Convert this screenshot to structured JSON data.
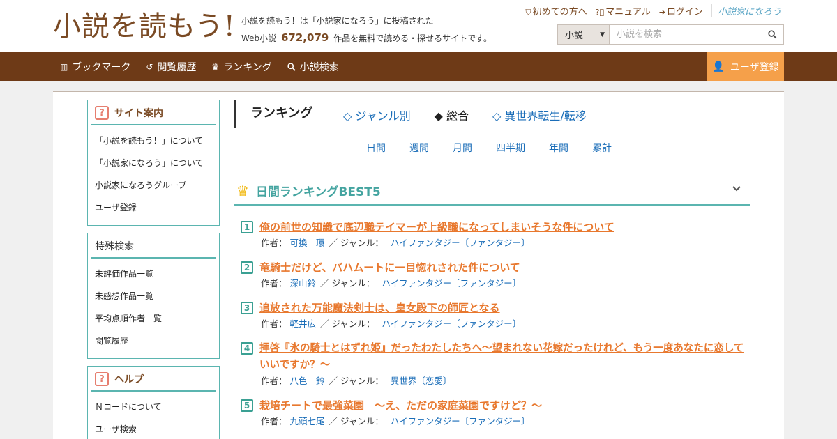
{
  "header": {
    "logo": "小説を読もう!",
    "tagline_line1": "小説を読もう！は「小説家になろう」に投稿された",
    "tagline_prefix": "Web小説",
    "work_count": "672,079",
    "tagline_suffix": "作品を無料で読める・探せるサイトです。",
    "links": [
      {
        "icon": "beginner-icon",
        "label": "初めての方へ"
      },
      {
        "icon": "help-icon",
        "label": "マニュアル"
      },
      {
        "icon": "login-icon",
        "label": "ログイン"
      }
    ],
    "partner_logo": "小説家になろう",
    "search": {
      "category": "小説",
      "placeholder": "小説を検索"
    }
  },
  "nav": {
    "items": [
      {
        "icon": "bookmark-icon",
        "label": "ブックマーク"
      },
      {
        "icon": "history-icon",
        "label": "閲覧履歴"
      },
      {
        "icon": "crown-icon",
        "label": "ランキング"
      },
      {
        "icon": "search-icon",
        "label": "小説検索"
      }
    ],
    "register": "ユーザ登録"
  },
  "sidebar": {
    "site_guide": {
      "title": "サイト案内",
      "items": [
        "「小説を読もう！」について",
        "「小説家になろう」について",
        "小説家になろうグループ",
        "ユーザ登録"
      ]
    },
    "special_search": {
      "title": "特殊検索",
      "items": [
        "未評価作品一覧",
        "未感想作品一覧",
        "平均点順作者一覧",
        "閲覧履歴"
      ]
    },
    "help": {
      "title": "ヘルプ",
      "items": [
        "Ｎコードについて",
        "ユーザ検索"
      ]
    }
  },
  "ranking": {
    "title": "ランキング",
    "tabs": [
      "◇ ジャンル別",
      "◆ 総合",
      "◇ 異世界転生/転移"
    ],
    "periods": [
      "日間",
      "週間",
      "月間",
      "四半期",
      "年間",
      "累計"
    ],
    "section_title": "日間ランキングBEST5",
    "author_label": "作者：",
    "genre_label": "／ ジャンル：",
    "entries": [
      {
        "rank": "1",
        "title": "俺の前世の知識で底辺職テイマーが上級職になってしまいそうな件について",
        "author": "可換　環",
        "genre": "ハイファンタジー〔ファンタジー〕"
      },
      {
        "rank": "2",
        "title": "竜騎士だけど、バハムートに一目惚れされた件について",
        "author": "深山鈴",
        "genre": "ハイファンタジー〔ファンタジー〕"
      },
      {
        "rank": "3",
        "title": "追放された万能魔法剣士は、皇女殿下の師匠となる",
        "author": "軽井広",
        "genre": "ハイファンタジー〔ファンタジー〕"
      },
      {
        "rank": "4",
        "title": "拝啓『氷の騎士とはずれ姫』だったわたしたちへ～望まれない花嫁だったけれど、もう一度あなたに恋していいですか？～",
        "author": "八色　鈴",
        "genre": "異世界〔恋愛〕"
      },
      {
        "rank": "5",
        "title": "栽培チートで最強菜園　～え、ただの家庭菜園ですけど？～",
        "author": "九頭七尾",
        "genre": "ハイファンタジー〔ファンタジー〕"
      }
    ]
  },
  "colors": {
    "brand_brown": "#6e3a17",
    "accent_orange": "#f5a04a",
    "teal": "#5bb5b0",
    "link_blue": "#1a6db8",
    "title_orange": "#e8782e"
  }
}
